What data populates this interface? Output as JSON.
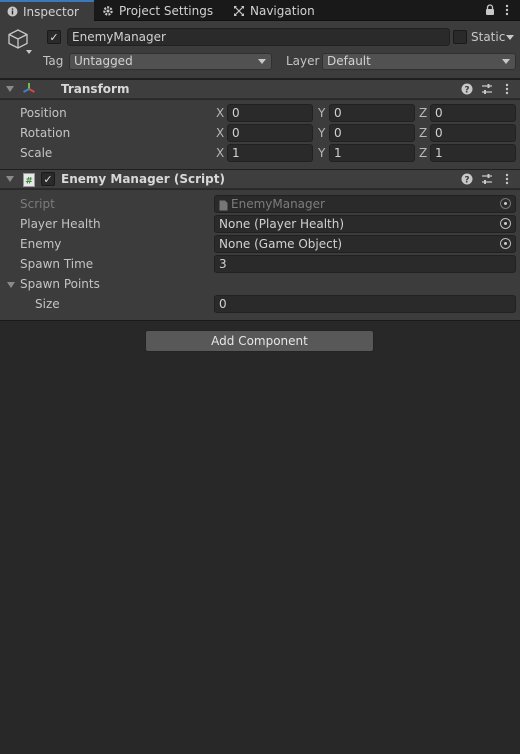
{
  "tabs": [
    {
      "label": "Inspector",
      "active": true,
      "icon": "info-icon"
    },
    {
      "label": "Project Settings",
      "active": false,
      "icon": "gear-icon"
    },
    {
      "label": "Navigation",
      "active": false,
      "icon": "navigation-icon"
    }
  ],
  "header": {
    "object_name": "EnemyManager",
    "active_checked": true,
    "static_label": "Static",
    "tag_label": "Tag",
    "tag_value": "Untagged",
    "layer_label": "Layer",
    "layer_value": "Default"
  },
  "transform": {
    "title": "Transform",
    "rows": [
      {
        "label": "Position",
        "x": "0",
        "y": "0",
        "z": "0"
      },
      {
        "label": "Rotation",
        "x": "0",
        "y": "0",
        "z": "0"
      },
      {
        "label": "Scale",
        "x": "1",
        "y": "1",
        "z": "1"
      }
    ],
    "axis_x": "X",
    "axis_y": "Y",
    "axis_z": "Z"
  },
  "script_component": {
    "title": "Enemy Manager (Script)",
    "enabled": true,
    "script_label": "Script",
    "script_value": "EnemyManager",
    "player_health_label": "Player Health",
    "player_health_value": "None (Player Health)",
    "enemy_label": "Enemy",
    "enemy_value": "None (Game Object)",
    "spawn_time_label": "Spawn Time",
    "spawn_time_value": "3",
    "spawn_points_label": "Spawn Points",
    "size_label": "Size",
    "size_value": "0"
  },
  "add_component_label": "Add Component",
  "colors": {
    "background": "#282828",
    "panel": "#3c3c3c",
    "accent": "#3a79bb"
  }
}
